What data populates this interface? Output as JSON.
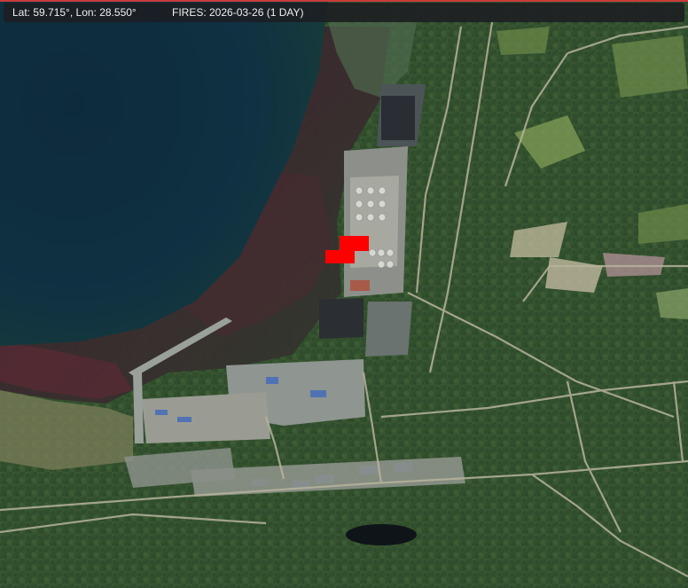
{
  "info_bar": {
    "coords_text": "Lat: 59.715°, Lon: 28.550°",
    "fires_text": "FIRES: 2026-03-26 (1 DAY)"
  },
  "map": {
    "type": "satellite",
    "colors": {
      "sea": "#0f2d3d",
      "forest": "#3b5a2f",
      "fire": "#ff0000",
      "top_border": "#c93b3b"
    }
  },
  "fires": {
    "date": "2026-03-26",
    "window": "1 DAY"
  }
}
